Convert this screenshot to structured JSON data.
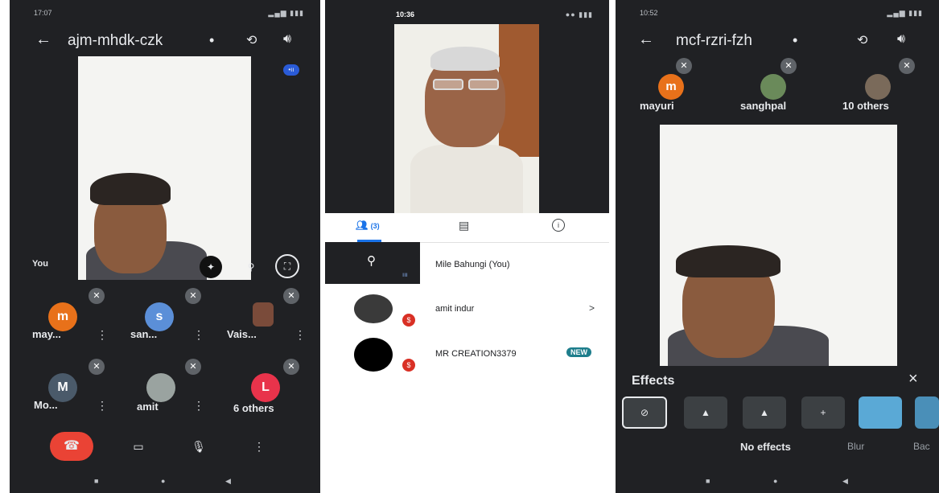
{
  "phone1": {
    "status_time": "17:07",
    "meeting_code": "ajm-mhdk-czk",
    "self_label": "You",
    "participants": [
      {
        "initial": "m",
        "name": "may...",
        "color": "#e8711a"
      },
      {
        "initial": "s",
        "name": "san...",
        "color": "#5b8fd8"
      },
      {
        "initial": "",
        "name": "Vais...",
        "color": "#7a4b3a"
      },
      {
        "initial": "M",
        "name": "Mo...",
        "color": "#4a5a6a"
      },
      {
        "initial": "",
        "name": "amit",
        "color": "#9aa3a0"
      },
      {
        "initial": "L",
        "name": "6 others",
        "color": "#e8334b"
      }
    ]
  },
  "phone2": {
    "status_time": "10:36",
    "tab_people_count": "(3)",
    "participants": [
      {
        "name": "Mile Bahungi (You)"
      },
      {
        "name": "amit indur",
        "action": ">"
      },
      {
        "name": "MR CREATION3379",
        "badge": "NEW"
      }
    ]
  },
  "phone3": {
    "status_time": "10:52",
    "meeting_code": "mcf-rzri-fzh",
    "top_participants": [
      {
        "initial": "m",
        "name": "mayuri",
        "color": "#e8711a"
      },
      {
        "initial": "",
        "name": "sanghpal",
        "color": "#6a8a5a"
      },
      {
        "initial": "",
        "name": "10 others",
        "color": "#7a6a5a"
      }
    ],
    "effects_title": "Effects",
    "close_label": "×",
    "effect_labels": {
      "none": "No effects",
      "blur": "Blur",
      "background": "Bac"
    }
  }
}
